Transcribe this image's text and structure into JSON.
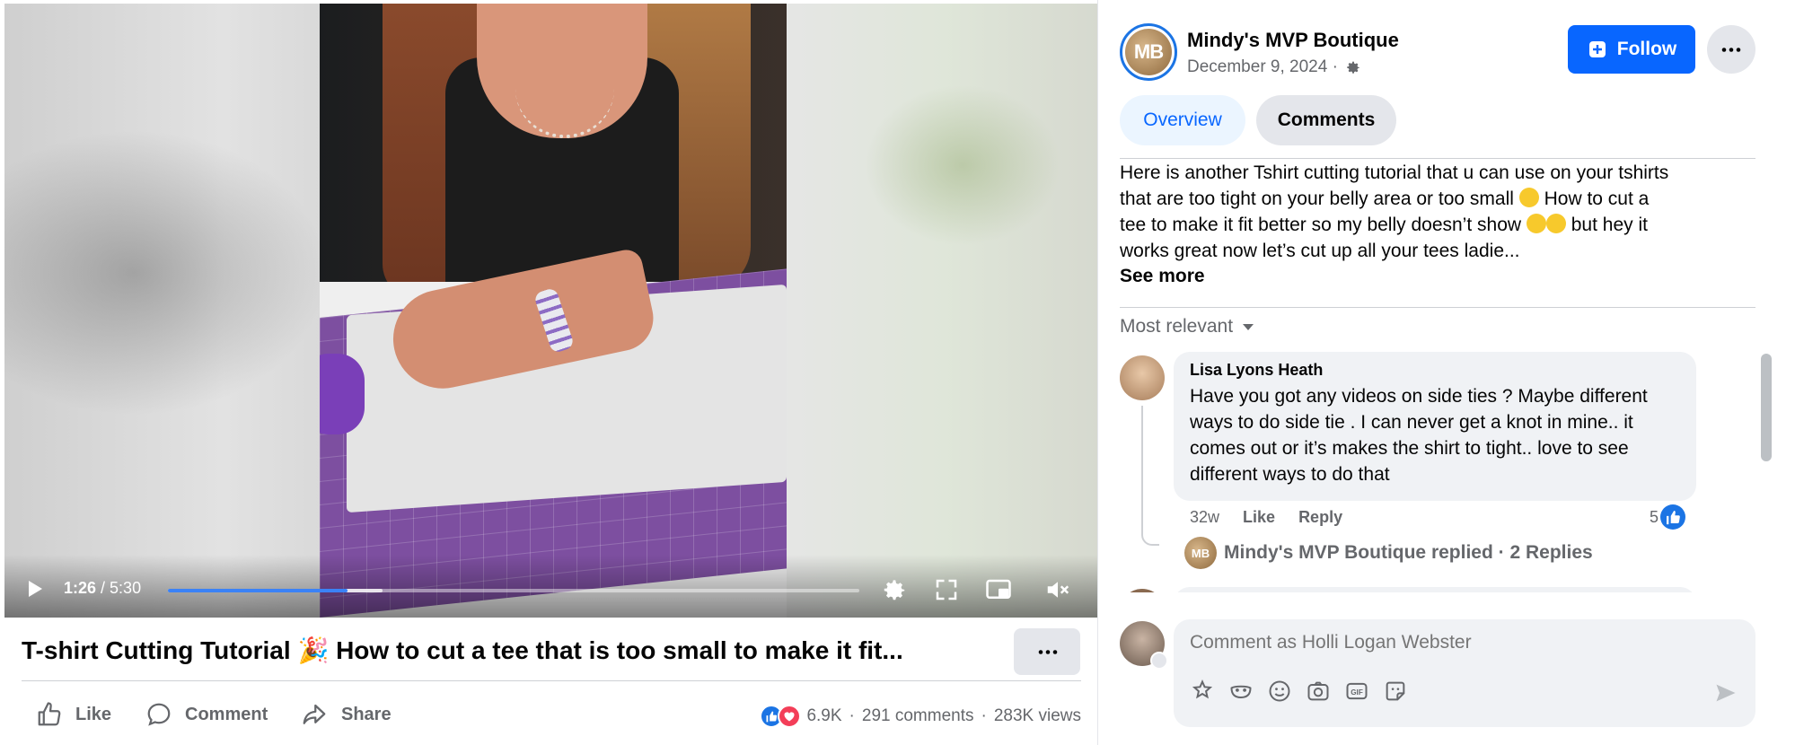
{
  "video": {
    "current_time": "1:26",
    "duration": "/ 5:30",
    "played_fraction": 0.26,
    "buffered_fraction": 0.31,
    "title": "T-shirt Cutting Tutorial 🎉 How to cut a tee that is too small to make it fit..."
  },
  "actions": {
    "like": "Like",
    "comment": "Comment",
    "share": "Share"
  },
  "stats": {
    "reactions": "6.9K",
    "separator": "·",
    "comments": "291 comments",
    "views": "283K views"
  },
  "page": {
    "initials": "MB",
    "name": "Mindy's MVP Boutique",
    "date": "December 9, 2024 ·",
    "follow_label": "Follow"
  },
  "tabs": {
    "overview": "Overview",
    "comments": "Comments"
  },
  "post": {
    "line1": "Here is another Tshirt cutting tutorial that u can use on your tshirts",
    "line2a": "that are too tight on your belly area or too small",
    "line2b": "How to cut a",
    "line3a": "tee to make it fit better so my belly doesn’t show",
    "line3b": "but hey it",
    "line4": "works great now let’s cut up all your tees ladie...",
    "see_more": "See more"
  },
  "sort_label": "Most relevant",
  "comment": {
    "author": "Lisa Lyons Heath",
    "text": "Have you got any videos on side ties ? Maybe different ways to do side tie . I can never get a knot in mine.. it comes out or it’s makes the shirt to tight.. love to see different ways to do that",
    "age": "32w",
    "like": "Like",
    "reply": "Reply",
    "like_count": "5",
    "replied_text": "Mindy's MVP Boutique replied · 2 Replies"
  },
  "composer": {
    "placeholder": "Comment as Holli Logan Webster"
  },
  "colors": {
    "accent": "#0866ff",
    "progress": "#3b82f6",
    "love": "#f33e58"
  }
}
